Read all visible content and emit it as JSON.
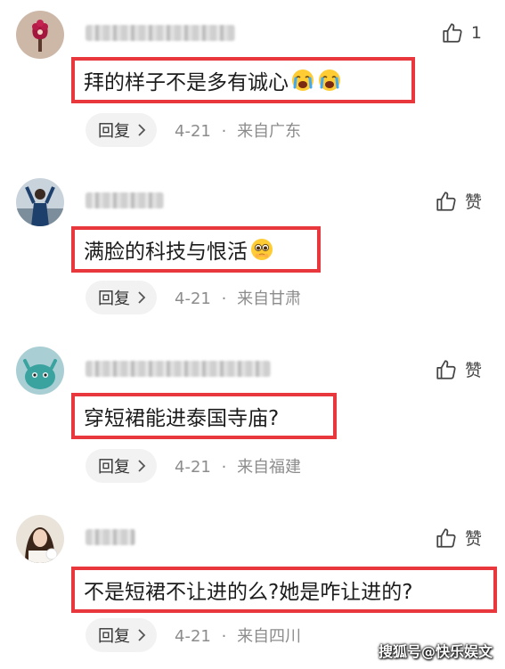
{
  "comments": [
    {
      "like_text": "1",
      "content": "拜的样子不是多有诚心",
      "emojis": [
        "loudly-crying-face-emoji",
        "loudly-crying-face-emoji"
      ],
      "reply_label": "回复",
      "date": "4-21",
      "separator": "·",
      "location": "来自广东"
    },
    {
      "like_text": "赞",
      "content": "满脸的科技与恨活",
      "emojis": [
        "pleading-face-emoji"
      ],
      "reply_label": "回复",
      "date": "4-21",
      "separator": "·",
      "location": "来自甘肃"
    },
    {
      "like_text": "赞",
      "content": "穿短裙能进泰国寺庙?",
      "emojis": [],
      "reply_label": "回复",
      "date": "4-21",
      "separator": "·",
      "location": "来自福建"
    },
    {
      "like_text": "赞",
      "content": "不是短裙不让进的么?她是咋让进的?",
      "emojis": [],
      "reply_label": "回复",
      "date": "4-21",
      "separator": "·",
      "location": "来自四川"
    }
  ],
  "watermark": "搜狐号@快乐娱文",
  "colors": {
    "highlight_border": "#e8383d",
    "meta_text": "#8c8c8c",
    "reply_bg": "#f2f2f2"
  }
}
